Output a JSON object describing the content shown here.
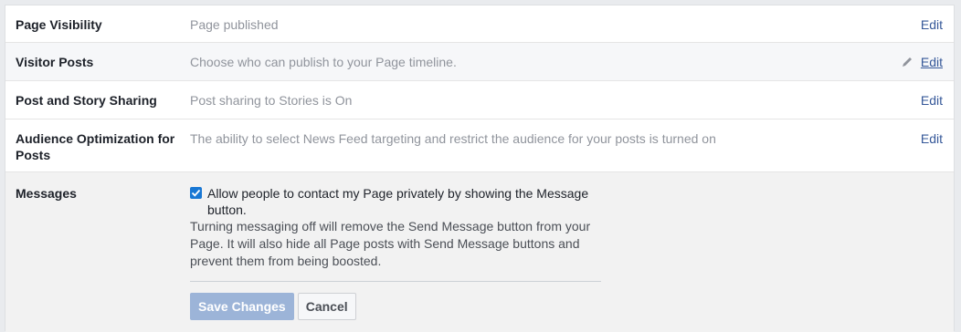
{
  "settings": {
    "rows": [
      {
        "label": "Page Visibility",
        "value": "Page published",
        "edit": "Edit"
      },
      {
        "label": "Visitor Posts",
        "value": "Choose who can publish to your Page timeline.",
        "edit": "Edit"
      },
      {
        "label": "Post and Story Sharing",
        "value": "Post sharing to Stories is On",
        "edit": "Edit"
      },
      {
        "label": "Audience Optimization for Posts",
        "value": "The ability to select News Feed targeting and restrict the audience for your posts is turned on",
        "edit": "Edit"
      }
    ],
    "messages": {
      "label": "Messages",
      "checkbox_label": "Allow people to contact my Page privately by showing the Message button.",
      "checked": true,
      "note": "Turning messaging off will remove the Send Message button from your Page. It will also hide all Page posts with Send Message buttons and prevent them from being boosted.",
      "save_label": "Save Changes",
      "cancel_label": "Cancel"
    }
  },
  "colors": {
    "link": "#365899",
    "save_disabled": "#9cb4d8",
    "checkbox": "#1877d4"
  },
  "icons": {
    "edit_pencil": "pencil-icon",
    "checkmark": "checkmark-icon"
  }
}
